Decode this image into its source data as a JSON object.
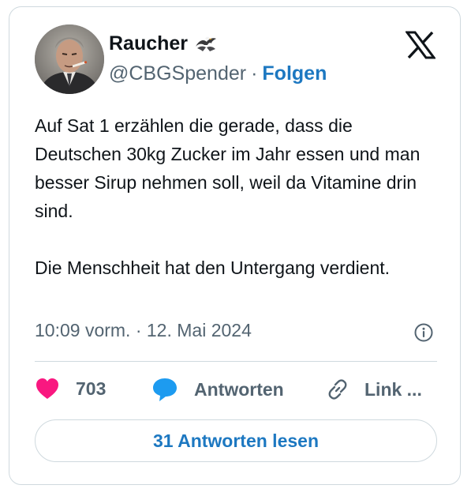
{
  "author": {
    "name": "Raucher",
    "badge_icon": "eagle-emoji-icon",
    "handle": "@CBGSpender",
    "separator": "·",
    "follow_label": "Folgen"
  },
  "tweet": {
    "text": "Auf Sat 1 erzählen die gerade, dass die Deutschen 30kg Zucker im Jahr essen und man besser Sirup nehmen soll, weil da Vitamine drin sind.\n\nDie Menschheit hat den Untergang verdient.",
    "timestamp": "10:09 vorm. · 12. Mai 2024"
  },
  "actions": {
    "like_count": "703",
    "reply_label": "Antworten",
    "link_label": "Link ..."
  },
  "read_replies_label": "31 Antworten lesen",
  "colors": {
    "accent": "#1d78c1",
    "like": "#f91880",
    "secondary_text": "#536471",
    "border": "#cfd9de"
  }
}
